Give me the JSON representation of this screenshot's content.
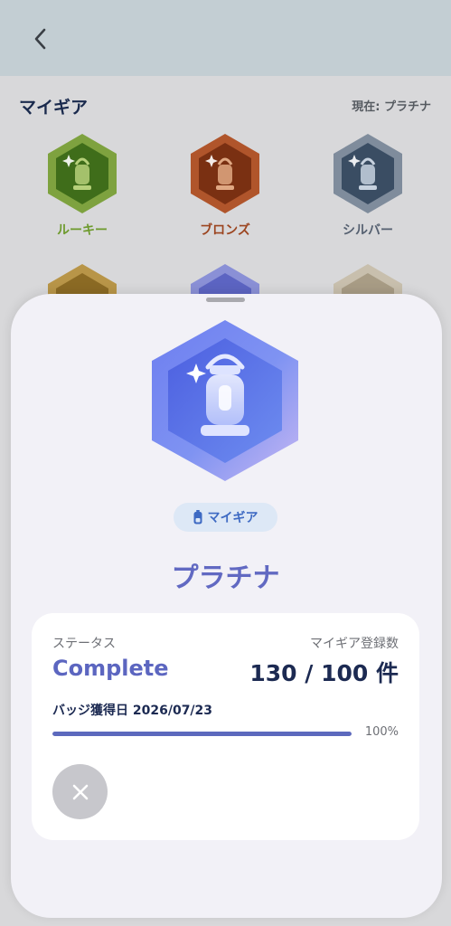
{
  "colors": {
    "header_bg": "#c3ced3",
    "accent": "#5c66c0",
    "navy": "#1c2a52",
    "rookie": "#6d9a2c",
    "bronze": "#9c4520",
    "silver": "#556070"
  },
  "header": {
    "back_icon": "chevron-left-icon"
  },
  "section": {
    "title": "マイギア",
    "current": "現在: プラチナ"
  },
  "badges": [
    {
      "label": "ルーキー",
      "icon": "lantern-icon"
    },
    {
      "label": "ブロンズ",
      "icon": "lantern-icon"
    },
    {
      "label": "シルバー",
      "icon": "lantern-icon"
    }
  ],
  "sheet": {
    "category": "マイギア",
    "category_icon": "battery-icon",
    "badge_name": "プラチナ",
    "status_label": "ステータス",
    "status_value": "Complete",
    "count_label": "マイギア登録数",
    "count_value": "130 / 100 件",
    "earned_date": "バッジ獲得日 2026/07/23",
    "progress_percent": 100,
    "progress_text": "100%",
    "close_icon": "close-icon"
  }
}
